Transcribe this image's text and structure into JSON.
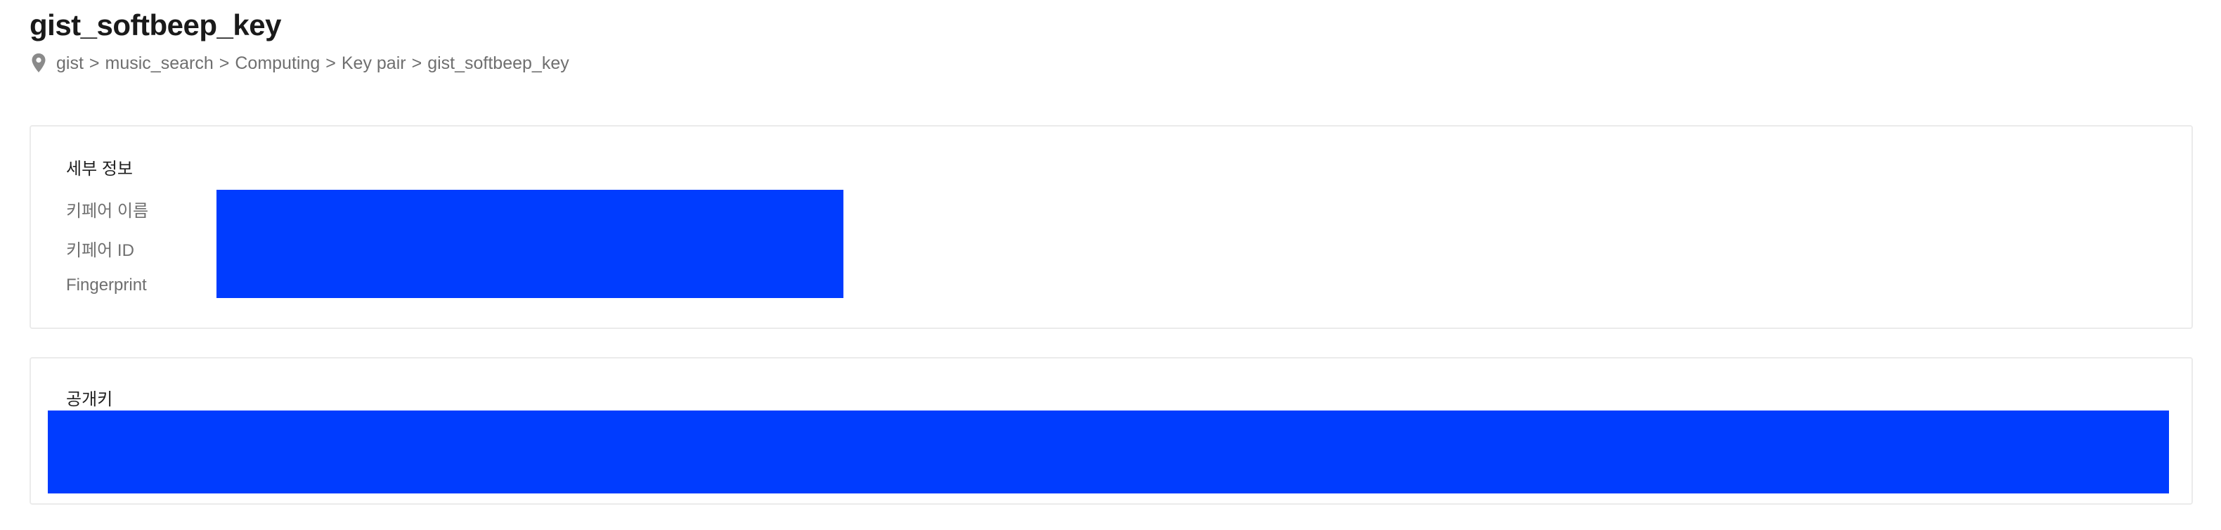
{
  "header": {
    "title": "gist_softbeep_key"
  },
  "breadcrumb": {
    "icon": "location-pin-icon",
    "items": [
      "gist",
      "music_search",
      "Computing",
      "Key pair",
      "gist_softbeep_key"
    ],
    "separator": ">"
  },
  "details": {
    "section_title": "세부 정보",
    "labels": {
      "keypair_name": "키페어 이름",
      "keypair_id": "키페어 ID",
      "fingerprint": "Fingerprint"
    }
  },
  "public_key": {
    "section_title": "공개키"
  },
  "colors": {
    "redaction": "#003cff",
    "border": "#ebebeb",
    "muted_text": "#6f6f6f"
  }
}
